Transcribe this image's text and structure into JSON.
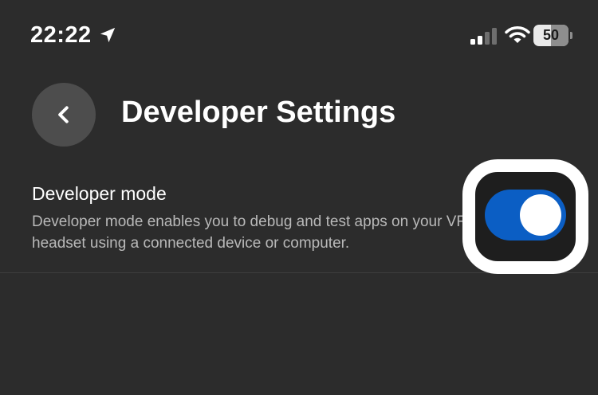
{
  "status_bar": {
    "time": "22:22",
    "battery": "50",
    "icons": [
      "location-arrow-icon",
      "cellular-signal-icon",
      "wifi-icon",
      "battery-icon"
    ]
  },
  "header": {
    "title": "Developer Settings",
    "back_icon": "chevron-left-icon"
  },
  "setting": {
    "title": "Developer mode",
    "description": "Developer mode enables you to debug and test apps on your VR headset using a connected device or computer.",
    "toggle_on": true
  },
  "colors": {
    "background": "#2c2c2c",
    "toggle_on": "#0b5ec4",
    "highlight": "#ffffff"
  }
}
